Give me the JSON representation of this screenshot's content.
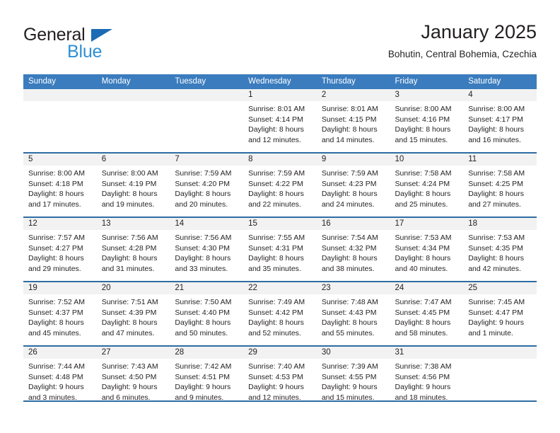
{
  "brand": {
    "name_part1": "General",
    "name_part2": "Blue",
    "triangle_icon": "triangle-icon",
    "colors": {
      "dark": "#231f20",
      "blue": "#2f8fd4",
      "triangle": "#1b6cb4"
    }
  },
  "header": {
    "title": "January 2025",
    "subtitle": "Bohutin, Central Bohemia, Czechia"
  },
  "calendar": {
    "header_bg": "#3a7cbe",
    "row_divider": "#2e6da4",
    "date_strip_bg": "#f2f2f2",
    "weekdays": [
      "Sunday",
      "Monday",
      "Tuesday",
      "Wednesday",
      "Thursday",
      "Friday",
      "Saturday"
    ],
    "weeks": [
      [
        {
          "day": "",
          "empty": true
        },
        {
          "day": "",
          "empty": true
        },
        {
          "day": "",
          "empty": true
        },
        {
          "day": "1",
          "sunrise": "Sunrise: 8:01 AM",
          "sunset": "Sunset: 4:14 PM",
          "daylight_line1": "Daylight: 8 hours",
          "daylight_line2": "and 12 minutes."
        },
        {
          "day": "2",
          "sunrise": "Sunrise: 8:01 AM",
          "sunset": "Sunset: 4:15 PM",
          "daylight_line1": "Daylight: 8 hours",
          "daylight_line2": "and 14 minutes."
        },
        {
          "day": "3",
          "sunrise": "Sunrise: 8:00 AM",
          "sunset": "Sunset: 4:16 PM",
          "daylight_line1": "Daylight: 8 hours",
          "daylight_line2": "and 15 minutes."
        },
        {
          "day": "4",
          "sunrise": "Sunrise: 8:00 AM",
          "sunset": "Sunset: 4:17 PM",
          "daylight_line1": "Daylight: 8 hours",
          "daylight_line2": "and 16 minutes."
        }
      ],
      [
        {
          "day": "5",
          "sunrise": "Sunrise: 8:00 AM",
          "sunset": "Sunset: 4:18 PM",
          "daylight_line1": "Daylight: 8 hours",
          "daylight_line2": "and 17 minutes."
        },
        {
          "day": "6",
          "sunrise": "Sunrise: 8:00 AM",
          "sunset": "Sunset: 4:19 PM",
          "daylight_line1": "Daylight: 8 hours",
          "daylight_line2": "and 19 minutes."
        },
        {
          "day": "7",
          "sunrise": "Sunrise: 7:59 AM",
          "sunset": "Sunset: 4:20 PM",
          "daylight_line1": "Daylight: 8 hours",
          "daylight_line2": "and 20 minutes."
        },
        {
          "day": "8",
          "sunrise": "Sunrise: 7:59 AM",
          "sunset": "Sunset: 4:22 PM",
          "daylight_line1": "Daylight: 8 hours",
          "daylight_line2": "and 22 minutes."
        },
        {
          "day": "9",
          "sunrise": "Sunrise: 7:59 AM",
          "sunset": "Sunset: 4:23 PM",
          "daylight_line1": "Daylight: 8 hours",
          "daylight_line2": "and 24 minutes."
        },
        {
          "day": "10",
          "sunrise": "Sunrise: 7:58 AM",
          "sunset": "Sunset: 4:24 PM",
          "daylight_line1": "Daylight: 8 hours",
          "daylight_line2": "and 25 minutes."
        },
        {
          "day": "11",
          "sunrise": "Sunrise: 7:58 AM",
          "sunset": "Sunset: 4:25 PM",
          "daylight_line1": "Daylight: 8 hours",
          "daylight_line2": "and 27 minutes."
        }
      ],
      [
        {
          "day": "12",
          "sunrise": "Sunrise: 7:57 AM",
          "sunset": "Sunset: 4:27 PM",
          "daylight_line1": "Daylight: 8 hours",
          "daylight_line2": "and 29 minutes."
        },
        {
          "day": "13",
          "sunrise": "Sunrise: 7:56 AM",
          "sunset": "Sunset: 4:28 PM",
          "daylight_line1": "Daylight: 8 hours",
          "daylight_line2": "and 31 minutes."
        },
        {
          "day": "14",
          "sunrise": "Sunrise: 7:56 AM",
          "sunset": "Sunset: 4:30 PM",
          "daylight_line1": "Daylight: 8 hours",
          "daylight_line2": "and 33 minutes."
        },
        {
          "day": "15",
          "sunrise": "Sunrise: 7:55 AM",
          "sunset": "Sunset: 4:31 PM",
          "daylight_line1": "Daylight: 8 hours",
          "daylight_line2": "and 35 minutes."
        },
        {
          "day": "16",
          "sunrise": "Sunrise: 7:54 AM",
          "sunset": "Sunset: 4:32 PM",
          "daylight_line1": "Daylight: 8 hours",
          "daylight_line2": "and 38 minutes."
        },
        {
          "day": "17",
          "sunrise": "Sunrise: 7:53 AM",
          "sunset": "Sunset: 4:34 PM",
          "daylight_line1": "Daylight: 8 hours",
          "daylight_line2": "and 40 minutes."
        },
        {
          "day": "18",
          "sunrise": "Sunrise: 7:53 AM",
          "sunset": "Sunset: 4:35 PM",
          "daylight_line1": "Daylight: 8 hours",
          "daylight_line2": "and 42 minutes."
        }
      ],
      [
        {
          "day": "19",
          "sunrise": "Sunrise: 7:52 AM",
          "sunset": "Sunset: 4:37 PM",
          "daylight_line1": "Daylight: 8 hours",
          "daylight_line2": "and 45 minutes."
        },
        {
          "day": "20",
          "sunrise": "Sunrise: 7:51 AM",
          "sunset": "Sunset: 4:39 PM",
          "daylight_line1": "Daylight: 8 hours",
          "daylight_line2": "and 47 minutes."
        },
        {
          "day": "21",
          "sunrise": "Sunrise: 7:50 AM",
          "sunset": "Sunset: 4:40 PM",
          "daylight_line1": "Daylight: 8 hours",
          "daylight_line2": "and 50 minutes."
        },
        {
          "day": "22",
          "sunrise": "Sunrise: 7:49 AM",
          "sunset": "Sunset: 4:42 PM",
          "daylight_line1": "Daylight: 8 hours",
          "daylight_line2": "and 52 minutes."
        },
        {
          "day": "23",
          "sunrise": "Sunrise: 7:48 AM",
          "sunset": "Sunset: 4:43 PM",
          "daylight_line1": "Daylight: 8 hours",
          "daylight_line2": "and 55 minutes."
        },
        {
          "day": "24",
          "sunrise": "Sunrise: 7:47 AM",
          "sunset": "Sunset: 4:45 PM",
          "daylight_line1": "Daylight: 8 hours",
          "daylight_line2": "and 58 minutes."
        },
        {
          "day": "25",
          "sunrise": "Sunrise: 7:45 AM",
          "sunset": "Sunset: 4:47 PM",
          "daylight_line1": "Daylight: 9 hours",
          "daylight_line2": "and 1 minute."
        }
      ],
      [
        {
          "day": "26",
          "sunrise": "Sunrise: 7:44 AM",
          "sunset": "Sunset: 4:48 PM",
          "daylight_line1": "Daylight: 9 hours",
          "daylight_line2": "and 3 minutes."
        },
        {
          "day": "27",
          "sunrise": "Sunrise: 7:43 AM",
          "sunset": "Sunset: 4:50 PM",
          "daylight_line1": "Daylight: 9 hours",
          "daylight_line2": "and 6 minutes."
        },
        {
          "day": "28",
          "sunrise": "Sunrise: 7:42 AM",
          "sunset": "Sunset: 4:51 PM",
          "daylight_line1": "Daylight: 9 hours",
          "daylight_line2": "and 9 minutes."
        },
        {
          "day": "29",
          "sunrise": "Sunrise: 7:40 AM",
          "sunset": "Sunset: 4:53 PM",
          "daylight_line1": "Daylight: 9 hours",
          "daylight_line2": "and 12 minutes."
        },
        {
          "day": "30",
          "sunrise": "Sunrise: 7:39 AM",
          "sunset": "Sunset: 4:55 PM",
          "daylight_line1": "Daylight: 9 hours",
          "daylight_line2": "and 15 minutes."
        },
        {
          "day": "31",
          "sunrise": "Sunrise: 7:38 AM",
          "sunset": "Sunset: 4:56 PM",
          "daylight_line1": "Daylight: 9 hours",
          "daylight_line2": "and 18 minutes."
        },
        {
          "day": "",
          "empty": true
        }
      ]
    ]
  }
}
